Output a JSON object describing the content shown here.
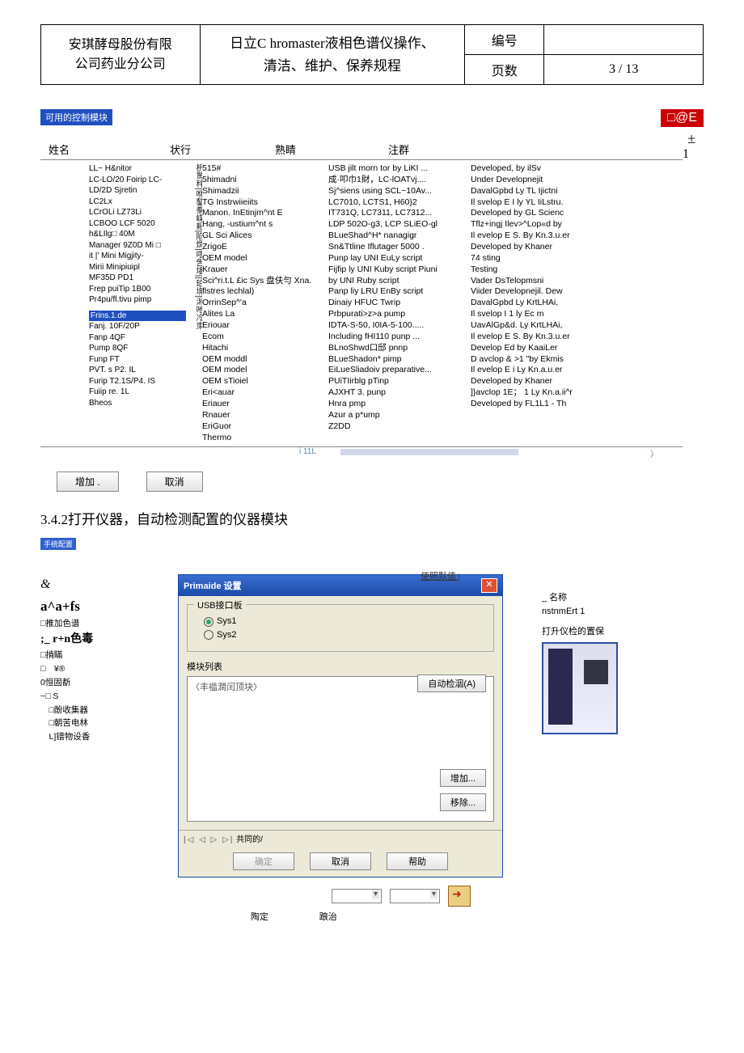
{
  "header": {
    "company_line1": "安琪酵母股份有限",
    "company_line2": "公司药业分公司",
    "doc_title_line1": "日立C hromaster液相色谱仪操作、",
    "doc_title_line2": "清洁、维护、保养规程",
    "code_label": "编号",
    "code_value": "",
    "page_label": "页数",
    "page_value": "3 / 13"
  },
  "tag1": "可用的控制模块",
  "at_e": "□@E",
  "pm": "±",
  "one": "1",
  "cols": {
    "c1": "姓名",
    "c2": "状行",
    "c3": "熟睛",
    "c4": "注群",
    "c5": ""
  },
  "name_list": [
    "LL~ H&nitor",
    "LC-LO/20 Foirip LC-",
    "LD/2D Sjretin",
    "LC2Lx",
    "LCrOLi LZ73Li",
    "LCBOO LCF 5020",
    "h&LIlg□ 40M",
    "Manager 9Z0D Mi □",
    "it |' Mini Migjity-",
    "Mirii Minipiuipl",
    "MF35D PD1",
    "Frep puiTip 1B00",
    "Pr4pu/fl.tivu pimp"
  ],
  "name_sel": "Frins.1.de",
  "name_list2": [
    "Fanj. 10F/20P",
    "Fanp 4QF",
    "Pump 8QF",
    "Funp FT",
    "PVT. s P2. IL",
    "Furip T2.1S/P4. IS",
    "Fuiip re. 1L",
    "Bheos"
  ],
  "garble": "枡駡秚|咻鏊豢嶫耜|陷煟|嘐吿墦||珀垹|潟吔冷朿",
  "detail1": [
    "515#",
    "5himadni",
    "Shimadzii",
    "TG Instrwiieiits",
    "Manon. InEtinjm^nt E",
    "Hang, -ustium^nt s",
    "GL Sci Alices",
    "ZrigoE",
    "OEM model",
    "Krauer",
    "Sci^ri.t.L £ic Sys 盘伕勻 Xna.",
    "flstres lechlal)",
    "",
    "OrrinSep^'a",
    "Alites La",
    "Eriouar",
    "Ecom",
    "Hitachi",
    "OEM moddl",
    "OEM model",
    "OEM sTioiel",
    "Eri<auar",
    "Eriauer",
    "Rnauer",
    "EriGuor",
    "Thermo"
  ],
  "detail2": [
    "USB jilt morn tor by LiKI ...",
    "成·叩巾1財，LC-lOATvj....",
    "Sj^siens using SCL~10Av...",
    "",
    "LC7010, LCTS1, H60}2",
    "IT731Q, LC7311, LC7312...",
    "",
    "LDP 502O-g3, LCP SLiEO-gl",
    "BLueShad^H* nanagigr",
    "Sn&Ttline Iflutager 5000 .",
    "Punp lay UNI EuLy script",
    "Fijfip ly UNI Kuby script Piuni",
    "by UNI Ruby script",
    "Panp liy LRU EnBy script",
    "Dinaiy HFUC Twrip",
    "Prbpurati>z>a pump",
    "IDTA-S-50, I0IA-5-100.....",
    "Including fHI110 punp ...",
    "BLnoShwd口邸 pnnp",
    "BLueShadon* pimp",
    "EiLueSliadoiv preparative...",
    "PUiTIirblg pTinp",
    "AJXHT 3. punp",
    "Hnra pmp",
    "Azur a p*ump",
    "Z2DD"
  ],
  "detail3": [
    "Developed, by ilSv",
    "",
    "",
    "Under Developnejit",
    "DavalGpbd Ly TL Ijictni",
    "Il svelop E I ly YL IiLstru.",
    "Developed by GL Scienc",
    "Tflz+ingj Ilev>^Lop«d by",
    "Il evelop E S. By Kn.3.u.er",
    "Developed by Khaner",
    "74 sting",
    "Testing",
    "",
    "Vader DsTelopmsni",
    "Viider Developnejil. Dew",
    "DavalGpbd Ly KrtLHAi,",
    "Il svelop I 1 ly Ec m",
    "",
    "UavAlGp&d. Ly KrtLHAi,",
    "Il evelop E S. By Kn.3.u.er",
    "Develop Ed by KaaiLer",
    "D avclop & >1 \"by Ekmis",
    "Il evelop E i Ly Kn.a.u.er",
    "Developed by Khaner",
    "]}avclop 1E；  1 Ly Kn.a.ii^r",
    "Developed by FL1L1 - Th"
  ],
  "i11l": "i 11L",
  "footer_arrow": "〉",
  "btn_add": "增加 .",
  "btn_cancel": "取消",
  "section": "3.4.2打开仪器，自动检测配置的仪器模块",
  "tag2": "手统配置",
  "left": {
    "amp": "&",
    "bold": "a^a+fs",
    "l1": "□推加色谱",
    "l2": ";_ r+n色毒",
    "l3": "□掯瞞",
    "l4": "□　¥®",
    "l5": "0恒固斱",
    "l6": "~□ S",
    "l7": "　□酚收集器",
    "l8": "　□朝苦电林",
    "l9": "　L]镨物设香"
  },
  "use_default": "使照默值 |",
  "dialog": {
    "title": "Primaide 设置",
    "grp1": "USB接口板",
    "sys1": "Sys1",
    "sys2": "Sys2",
    "grp2": "模块列表",
    "list_placeholder": "〈丰褴澗闰顶块〉",
    "auto": "自动检洇(A)",
    "add": "增加...",
    "del": "移除...",
    "tabs_nav": "|◁ ◁ ▷ ▷|",
    "tabs": "共同的/",
    "ok": "确定",
    "can": "取消",
    "help": "帮助"
  },
  "right": {
    "name_label": "_ 名称",
    "name_val": "nstnmErt 1",
    "inst": "打升仪检的置保"
  },
  "below": {
    "ok": "陶定",
    "can": "踉治"
  }
}
